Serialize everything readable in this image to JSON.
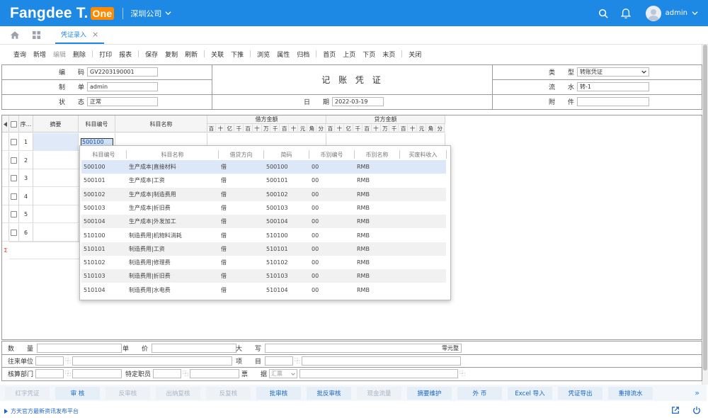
{
  "app": {
    "logo_text": "Fangdee T.",
    "logo_badge": "One",
    "company": "深圳公司",
    "user": "admin"
  },
  "tabs": {
    "active": "凭证录入"
  },
  "toolbar": [
    {
      "label": "查询",
      "enabled": true
    },
    {
      "label": "新增",
      "enabled": true
    },
    {
      "label": "编辑",
      "enabled": false
    },
    {
      "label": "删除",
      "enabled": true
    },
    {
      "sep": true
    },
    {
      "label": "打印",
      "enabled": true
    },
    {
      "label": "报表",
      "enabled": true
    },
    {
      "sep": true
    },
    {
      "label": "保存",
      "enabled": true
    },
    {
      "label": "复制",
      "enabled": true
    },
    {
      "label": "刷新",
      "enabled": true
    },
    {
      "sep": true
    },
    {
      "label": "关联",
      "enabled": true
    },
    {
      "label": "下推",
      "enabled": true
    },
    {
      "sep": true
    },
    {
      "label": "浏览",
      "enabled": true
    },
    {
      "label": "属性",
      "enabled": true
    },
    {
      "label": "归档",
      "enabled": true
    },
    {
      "sep": true
    },
    {
      "label": "首页",
      "enabled": true
    },
    {
      "label": "上页",
      "enabled": true
    },
    {
      "label": "下页",
      "enabled": true
    },
    {
      "label": "末页",
      "enabled": true
    },
    {
      "sep": true
    },
    {
      "label": "关闭",
      "enabled": true
    }
  ],
  "voucher": {
    "title": "记 账 凭 证",
    "code_label": "编　　码",
    "code": "GV2203190001",
    "maker_label": "制　　单",
    "maker": "admin",
    "status_label": "状　　态",
    "status": "正常",
    "date_label": "日　　期",
    "date": "2022-03-19",
    "type_label": "类　　型",
    "type": "转账凭证",
    "serial_label": "流　　水",
    "serial": "转-1",
    "attach_label": "附　　件",
    "attach": ""
  },
  "grid": {
    "headers": {
      "seq": "序...",
      "summary": "摘要",
      "account_code": "科目编号",
      "account_name": "科目名称",
      "debit": "借方金额",
      "credit": "贷方金额"
    },
    "digits": [
      "百",
      "十",
      "亿",
      "千",
      "百",
      "十",
      "万",
      "千",
      "百",
      "十",
      "元",
      "角",
      "分"
    ],
    "rows": [
      {
        "seq": "1",
        "code": "500100"
      },
      {
        "seq": "2",
        "code": ""
      },
      {
        "seq": "3",
        "code": ""
      },
      {
        "seq": "4",
        "code": ""
      },
      {
        "seq": "5",
        "code": ""
      },
      {
        "seq": "6",
        "code": ""
      }
    ],
    "total_mark": "Σ"
  },
  "lookup": {
    "headers": [
      "科目编号",
      "科目名称",
      "借贷方向",
      "简码",
      "币别编号",
      "币别名称",
      "买废料收入"
    ],
    "rows": [
      [
        "500100",
        "生产成本|直接材料",
        "借",
        "500100",
        "00",
        "RMB"
      ],
      [
        "500101",
        "生产成本|工资",
        "借",
        "500101",
        "00",
        "RMB"
      ],
      [
        "500102",
        "生产成本|制造费用",
        "借",
        "500102",
        "00",
        "RMB"
      ],
      [
        "500103",
        "生产成本|折旧费",
        "借",
        "500103",
        "00",
        "RMB"
      ],
      [
        "500104",
        "生产成本|外发加工",
        "借",
        "500104",
        "00",
        "RMB"
      ],
      [
        "510100",
        "制造费用|机物料消耗",
        "借",
        "510100",
        "00",
        "RMB"
      ],
      [
        "510101",
        "制造费用|工资",
        "借",
        "510101",
        "00",
        "RMB"
      ],
      [
        "510102",
        "制造费用|修理费",
        "借",
        "510102",
        "00",
        "RMB"
      ],
      [
        "510103",
        "制造费用|折旧费",
        "借",
        "510103",
        "00",
        "RMB"
      ],
      [
        "510104",
        "制造费用|水电费",
        "借",
        "510104",
        "00",
        "RMB"
      ]
    ]
  },
  "bottom": {
    "qty_label": "数　　量",
    "price_label": "单　　价",
    "capital_label": "大　　写",
    "capital_value": "零元整",
    "partner_label": "往来单位",
    "project_label": "项　　目",
    "dept_label": "核算部门",
    "staff_label": "特定职员",
    "bill_label": "票　　据",
    "bill_value": "汇票"
  },
  "actions": [
    {
      "label": "红字凭证",
      "enabled": false
    },
    {
      "label": "审 核",
      "enabled": true
    },
    {
      "label": "反审核",
      "enabled": false
    },
    {
      "label": "出纳复核",
      "enabled": false
    },
    {
      "label": "反复核",
      "enabled": false
    },
    {
      "label": "批审核",
      "enabled": true
    },
    {
      "label": "批反审核",
      "enabled": true
    },
    {
      "label": "现金流量",
      "enabled": false
    },
    {
      "label": "摘要维护",
      "enabled": true
    },
    {
      "label": "外 币",
      "enabled": true
    },
    {
      "label": "Excel 导入",
      "enabled": true
    },
    {
      "label": "凭证导出",
      "enabled": true
    },
    {
      "label": "重排流水",
      "enabled": true
    }
  ],
  "footer": {
    "news": "方天官方最新资讯发布平台"
  },
  "colors": {
    "primary": "#1e88e5",
    "accent": "#ff8a00"
  }
}
